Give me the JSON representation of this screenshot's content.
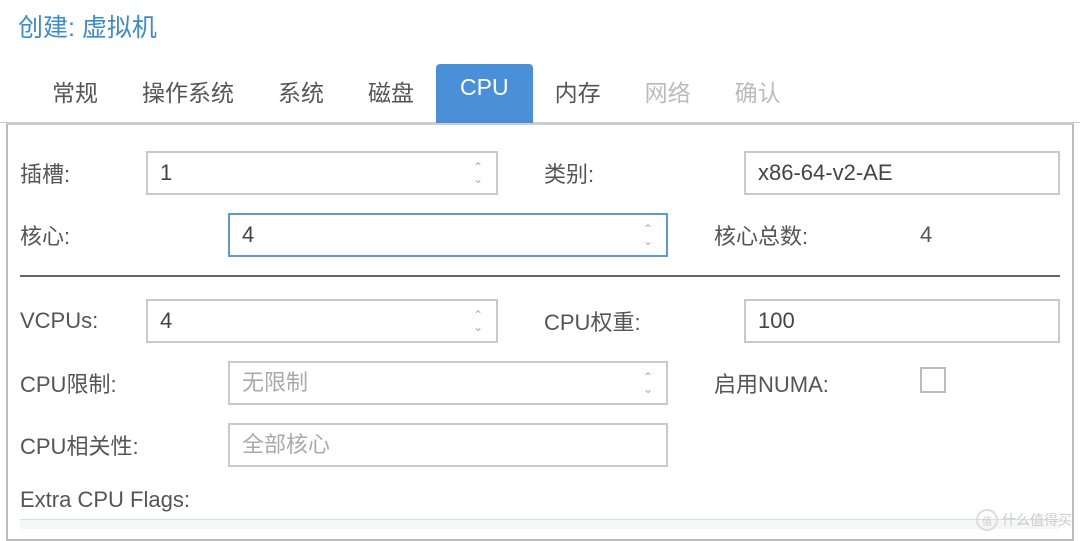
{
  "window": {
    "title": "创建: 虚拟机"
  },
  "tabs": [
    {
      "label": "常规",
      "active": false,
      "disabled": false
    },
    {
      "label": "操作系统",
      "active": false,
      "disabled": false
    },
    {
      "label": "系统",
      "active": false,
      "disabled": false
    },
    {
      "label": "磁盘",
      "active": false,
      "disabled": false
    },
    {
      "label": "CPU",
      "active": true,
      "disabled": false
    },
    {
      "label": "内存",
      "active": false,
      "disabled": false
    },
    {
      "label": "网络",
      "active": false,
      "disabled": true
    },
    {
      "label": "确认",
      "active": false,
      "disabled": true
    }
  ],
  "form": {
    "sockets": {
      "label": "插槽:",
      "value": "1"
    },
    "cores": {
      "label": "核心:",
      "value": "4"
    },
    "type": {
      "label": "类别:",
      "value": "x86-64-v2-AE"
    },
    "total_cores": {
      "label": "核心总数:",
      "value": "4"
    },
    "vcpus": {
      "label": "VCPUs:",
      "value": "4"
    },
    "cpu_weight": {
      "label": "CPU权重:",
      "value": "100"
    },
    "cpu_limit": {
      "label": "CPU限制:",
      "placeholder": "无限制"
    },
    "enable_numa": {
      "label": "启用NUMA:",
      "checked": false
    },
    "cpu_affinity": {
      "label": "CPU相关性:",
      "placeholder": "全部核心"
    },
    "extra_flags": {
      "label": "Extra CPU Flags:"
    }
  },
  "watermark": {
    "text": "什么值得买"
  }
}
